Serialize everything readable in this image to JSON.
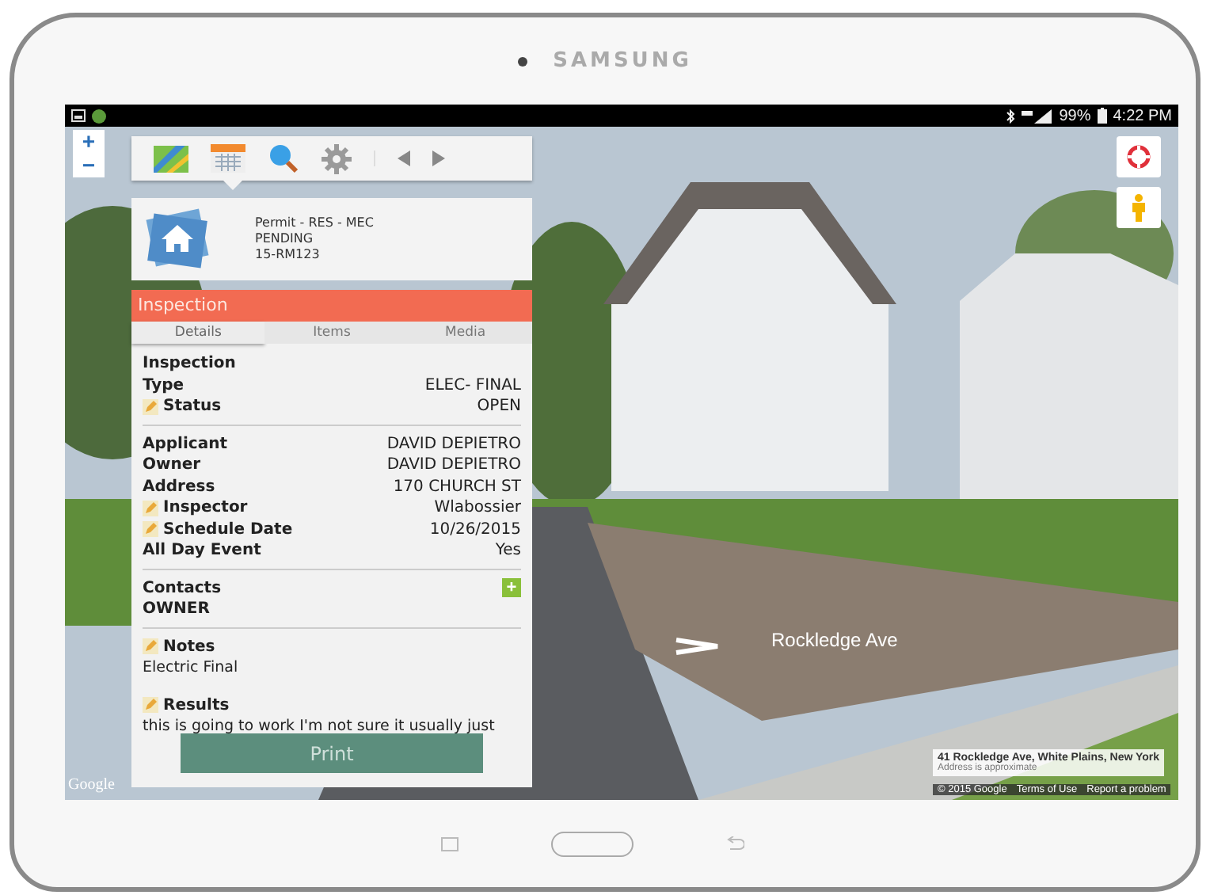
{
  "device": {
    "brand": "SAMSUNG"
  },
  "status_bar": {
    "battery": "99%",
    "time": "4:22 PM"
  },
  "map": {
    "zoom_in": "+",
    "zoom_out": "−",
    "street_label": "Rockledge Ave",
    "address": "41 Rockledge Ave, White Plains, New York",
    "address_note": "Address is approximate",
    "logo": "Google",
    "footer": [
      "© 2015 Google",
      "Terms of Use",
      "Report a problem"
    ]
  },
  "record": {
    "type": "Permit - RES - MEC",
    "status": "PENDING",
    "number": "15-RM123"
  },
  "panel": {
    "title": "Inspection",
    "tabs": [
      {
        "label": "Details",
        "selected": true
      },
      {
        "label": "Items",
        "selected": false
      },
      {
        "label": "Media",
        "selected": false
      }
    ],
    "blocks": [
      {
        "kind": "fields",
        "rows": [
          {
            "label": "Inspection",
            "editable": false
          },
          {
            "label": "Type",
            "value": "ELEC- FINAL",
            "editable": false
          },
          {
            "label": "Status",
            "value": "OPEN",
            "editable": true
          }
        ]
      },
      {
        "kind": "fields",
        "rows": [
          {
            "label": "Applicant",
            "value": "DAVID DEPIETRO",
            "editable": false
          },
          {
            "label": "Owner",
            "value": "DAVID DEPIETRO",
            "editable": false
          },
          {
            "label": "Address",
            "value": "170 CHURCH ST",
            "editable": false
          },
          {
            "label": "Inspector",
            "value": "Wlabossier",
            "editable": true
          },
          {
            "label": "Schedule Date",
            "value": "10/26/2015",
            "editable": true
          },
          {
            "label": "All Day Event",
            "value": "Yes",
            "editable": false
          }
        ]
      },
      {
        "kind": "contacts",
        "label": "Contacts",
        "add": "+",
        "items": [
          "OWNER"
        ]
      },
      {
        "kind": "note",
        "label": "Notes",
        "text": "Electric Final",
        "editable": true
      },
      {
        "kind": "note",
        "label": "Results",
        "text": "this is going to work I'm not sure it usually just",
        "editable": true
      }
    ],
    "print": "Print"
  }
}
